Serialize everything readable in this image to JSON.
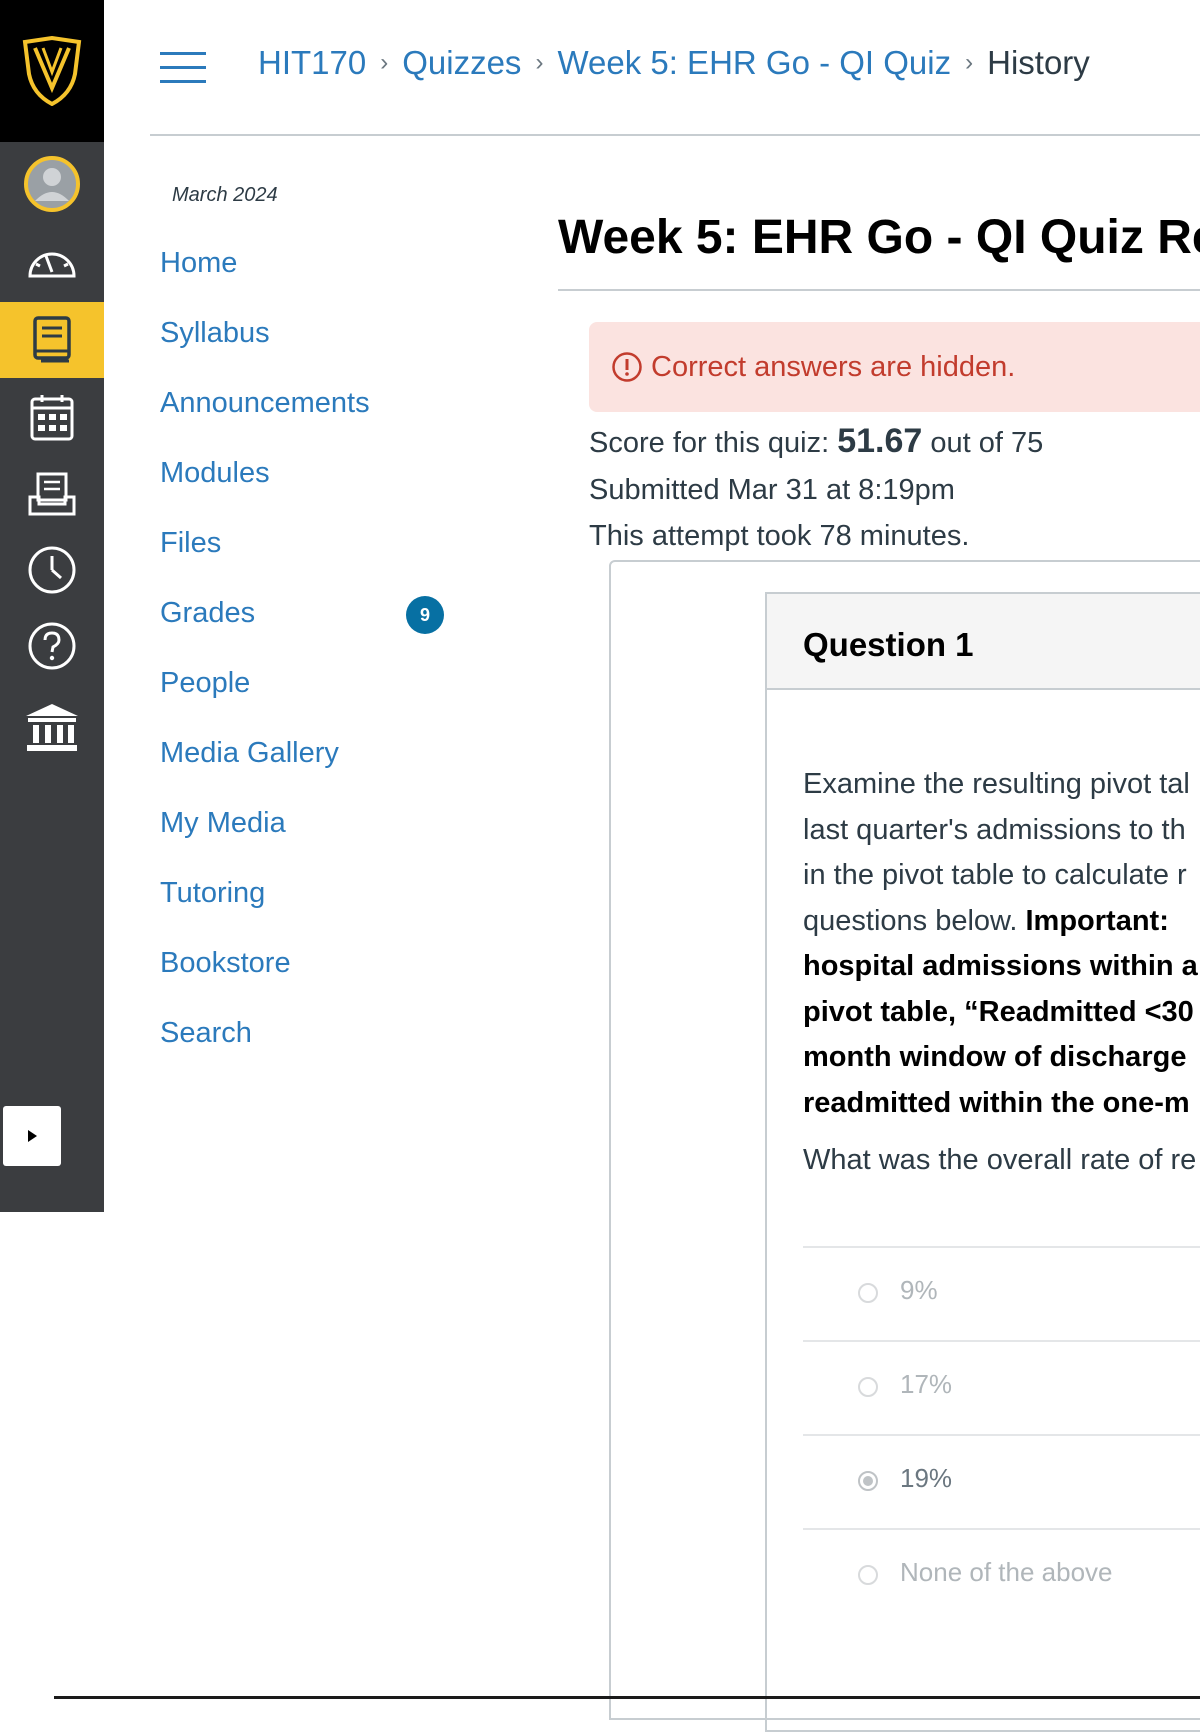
{
  "global_nav": {
    "items": [
      {
        "name": "account",
        "icon": "account-avatar-icon"
      },
      {
        "name": "dashboard",
        "icon": "dashboard-gauge-icon"
      },
      {
        "name": "courses",
        "icon": "courses-book-icon",
        "active": true
      },
      {
        "name": "calendar",
        "icon": "calendar-icon"
      },
      {
        "name": "inbox",
        "icon": "inbox-icon"
      },
      {
        "name": "history",
        "icon": "clock-icon"
      },
      {
        "name": "help",
        "icon": "help-circle-icon"
      },
      {
        "name": "institution",
        "icon": "institution-building-icon"
      }
    ],
    "accent_color": "#f5c32c"
  },
  "breadcrumb": {
    "items": [
      "HIT170",
      "Quizzes",
      "Week 5: EHR Go - QI Quiz"
    ],
    "current": "History",
    "separator": "›"
  },
  "course_nav": {
    "term": "March 2024",
    "items": [
      "Home",
      "Syllabus",
      "Announcements",
      "Modules",
      "Files",
      "Grades",
      "People",
      "Media Gallery",
      "My Media",
      "Tutoring",
      "Bookstore",
      "Search"
    ],
    "grades_badge": "9"
  },
  "main": {
    "title": "Week 5: EHR Go - QI Quiz Re",
    "alert": "Correct answers are hidden.",
    "score_prefix": "Score for this quiz:",
    "score_value": "51.67",
    "score_suffix": "out of 75",
    "submitted": "Submitted Mar 31 at 8:19pm",
    "attempt": "This attempt took 78 minutes."
  },
  "question": {
    "title": "Question 1",
    "text_lines": [
      {
        "text": "Examine the resulting pivot tal",
        "bold": false
      },
      {
        "text": "last quarter's admissions to th",
        "bold": false
      },
      {
        "text": "in the pivot table to calculate r",
        "bold": false
      },
      {
        "text": "questions below.",
        "bold": false,
        "bold_tail": "Important:"
      },
      {
        "text": "hospital admissions within a",
        "bold": true
      },
      {
        "text": "pivot table, “Readmitted <30",
        "bold": true
      },
      {
        "text": "month window of discharge",
        "bold": true
      },
      {
        "text": "readmitted within the one-m",
        "bold": true
      }
    ],
    "prompt": "What was the overall rate of re",
    "answers": [
      {
        "label": "9%",
        "selected": false
      },
      {
        "label": "17%",
        "selected": false
      },
      {
        "label": "19%",
        "selected": true
      },
      {
        "label": "None of the above",
        "selected": false
      }
    ]
  }
}
